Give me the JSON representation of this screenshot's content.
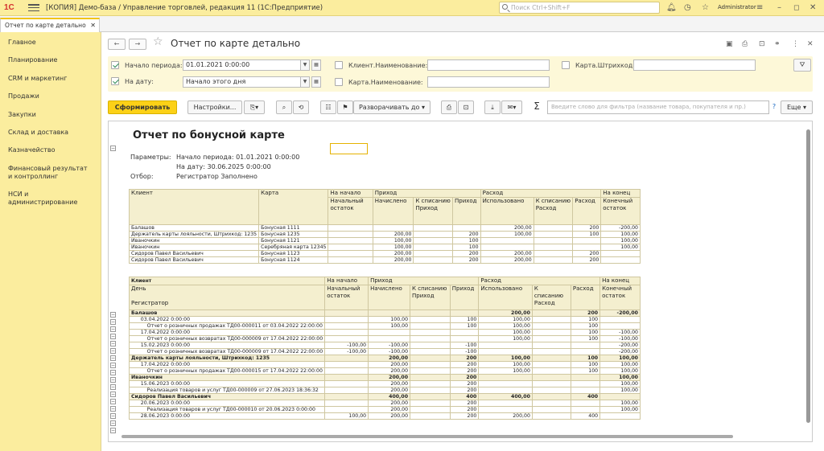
{
  "header": {
    "logo": "1С",
    "app_title": "[КОПИЯ] Демо-база / Управление торговлей, редакция 11  (1С:Предприятие)",
    "search_placeholder": "Поиск Ctrl+Shift+F",
    "user": "Administrator"
  },
  "tab": {
    "label": "Отчет по карте детально"
  },
  "sidebar": {
    "items": [
      "Главное",
      "Планирование",
      "CRM и маркетинг",
      "Продажи",
      "Закупки",
      "Склад и доставка",
      "Казначейство",
      "Финансовый результат и контроллинг",
      "НСИ и администрирование"
    ]
  },
  "form": {
    "title": "Отчет по карте детально",
    "filters": {
      "start_label": "Начало периода:",
      "start_value": "01.01.2021  0:00:00",
      "date_label": "На дату:",
      "date_value": "Начало этого дня",
      "client_label": "Клиент.Наименование:",
      "card_label": "Карта.Наименование:",
      "barcode_label": "Карта.Штрихкод:"
    },
    "toolbar": {
      "generate": "Сформировать",
      "settings": "Настройки...",
      "expand": "Разворачивать до",
      "filter_placeholder": "Введите слово для фильтра (название товара, покупателя и пр.)",
      "more": "Еще",
      "help": "?"
    }
  },
  "report": {
    "title": "Отчет по бонусной карте",
    "params_label": "Параметры:",
    "param1": "Начало периода: 01.01.2021 0:00:00",
    "param2": "На дату: 30.06.2025 0:00:00",
    "filter_label": "Отбор:",
    "filter_value": "Регистратор Заполнено",
    "t1_headers": {
      "client": "Клиент",
      "card": "Карта",
      "start": "На начало",
      "income": "Приход",
      "expense": "Расход",
      "end": "На конец",
      "start_bal": "Начальный остаток",
      "accrued": "Начислено",
      "to_write_income": "К списанию Приход",
      "income2": "Приход",
      "used": "Использовано",
      "to_write_expense": "К списанию Расход",
      "expense2": "Расход",
      "end_bal": "Конечный остаток"
    },
    "t1_rows": [
      [
        "Балашов",
        "Бонусная 1111",
        "",
        "",
        "",
        "",
        "200,00",
        "",
        "200",
        "-200,00"
      ],
      [
        "Держатель карты лояльности, Штрихкод: 1235",
        "Бонусная 1235",
        "",
        "200,00",
        "",
        "200",
        "100,00",
        "",
        "100",
        "100,00"
      ],
      [
        "Иваночкин",
        "Бонусная 1121",
        "",
        "100,00",
        "",
        "100",
        "",
        "",
        "",
        "100,00"
      ],
      [
        "Иваночкин",
        "Серебряная карта 12345",
        "",
        "100,00",
        "",
        "100",
        "",
        "",
        "",
        "100,00"
      ],
      [
        "Сидоров Павел Васильевич",
        "Бонусная 1123",
        "",
        "200,00",
        "",
        "200",
        "200,00",
        "",
        "200",
        ""
      ],
      [
        "Сидоров Павел Васильевич",
        "Бонусная 1124",
        "",
        "200,00",
        "",
        "200",
        "200,00",
        "",
        "200",
        ""
      ]
    ],
    "t2_headers": {
      "client": "Клиент",
      "day": "День",
      "registrar": "Регистратор"
    },
    "t2_rows": [
      {
        "g": 1,
        "c": [
          "Балашов",
          "",
          "",
          "",
          "",
          "200,00",
          "",
          "200",
          "-200,00"
        ]
      },
      {
        "g": 0,
        "c": [
          "      03.04.2022 0:00:00",
          "",
          "100,00",
          "",
          "100",
          "100,00",
          "",
          "100",
          ""
        ]
      },
      {
        "g": 0,
        "c": [
          "          Отчет о розничных продажах ТД00-000011 от 03.04.2022 22:00:00",
          "",
          "100,00",
          "",
          "100",
          "100,00",
          "",
          "100",
          ""
        ]
      },
      {
        "g": 0,
        "c": [
          "      17.04.2022 0:00:00",
          "",
          "",
          "",
          "",
          "100,00",
          "",
          "100",
          "-100,00"
        ]
      },
      {
        "g": 0,
        "c": [
          "          Отчет о розничных возвратах ТД00-000009 от 17.04.2022 22:00:00",
          "",
          "",
          "",
          "",
          "100,00",
          "",
          "100",
          "-100,00"
        ]
      },
      {
        "g": 0,
        "c": [
          "      15.02.2023 0:00:00",
          "-100,00",
          "-100,00",
          "",
          "-100",
          "",
          "",
          "",
          "-200,00"
        ]
      },
      {
        "g": 0,
        "c": [
          "          Отчет о розничных возвратах ТД00-000009 от 17.04.2022 22:00:00",
          "-100,00",
          "-100,00",
          "",
          "-100",
          "",
          "",
          "",
          "-200,00"
        ]
      },
      {
        "g": 1,
        "c": [
          "Держатель карты лояльности, Штрихкод: 1235",
          "",
          "200,00",
          "",
          "200",
          "100,00",
          "",
          "100",
          "100,00"
        ]
      },
      {
        "g": 0,
        "c": [
          "      17.04.2022 0:00:00",
          "",
          "200,00",
          "",
          "200",
          "100,00",
          "",
          "100",
          "100,00"
        ]
      },
      {
        "g": 0,
        "c": [
          "          Отчет о розничных продажах ТД00-000015 от 17.04.2022 22:00:00",
          "",
          "200,00",
          "",
          "200",
          "100,00",
          "",
          "100",
          "100,00"
        ]
      },
      {
        "g": 1,
        "c": [
          "Иваночкин",
          "",
          "200,00",
          "",
          "200",
          "",
          "",
          "",
          "100,00"
        ]
      },
      {
        "g": 0,
        "c": [
          "      15.06.2023 0:00:00",
          "",
          "200,00",
          "",
          "200",
          "",
          "",
          "",
          "100,00"
        ]
      },
      {
        "g": 0,
        "c": [
          "          Реализация товаров и услуг ТД00-000009 от 27.06.2023 18:36:32",
          "",
          "200,00",
          "",
          "200",
          "",
          "",
          "",
          "100,00"
        ]
      },
      {
        "g": 1,
        "c": [
          "Сидоров Павел Васильевич",
          "",
          "400,00",
          "",
          "400",
          "400,00",
          "",
          "400",
          ""
        ]
      },
      {
        "g": 0,
        "c": [
          "      20.06.2023 0:00:00",
          "",
          "200,00",
          "",
          "200",
          "",
          "",
          "",
          "100,00"
        ]
      },
      {
        "g": 0,
        "c": [
          "          Реализация товаров и услуг ТД00-000010 от 20.06.2023 0:00:00",
          "",
          "200,00",
          "",
          "200",
          "",
          "",
          "",
          "100,00"
        ]
      },
      {
        "g": 0,
        "c": [
          "      28.06.2023 0:00:00",
          "100,00",
          "200,00",
          "",
          "200",
          "200,00",
          "",
          "400",
          ""
        ]
      }
    ]
  }
}
